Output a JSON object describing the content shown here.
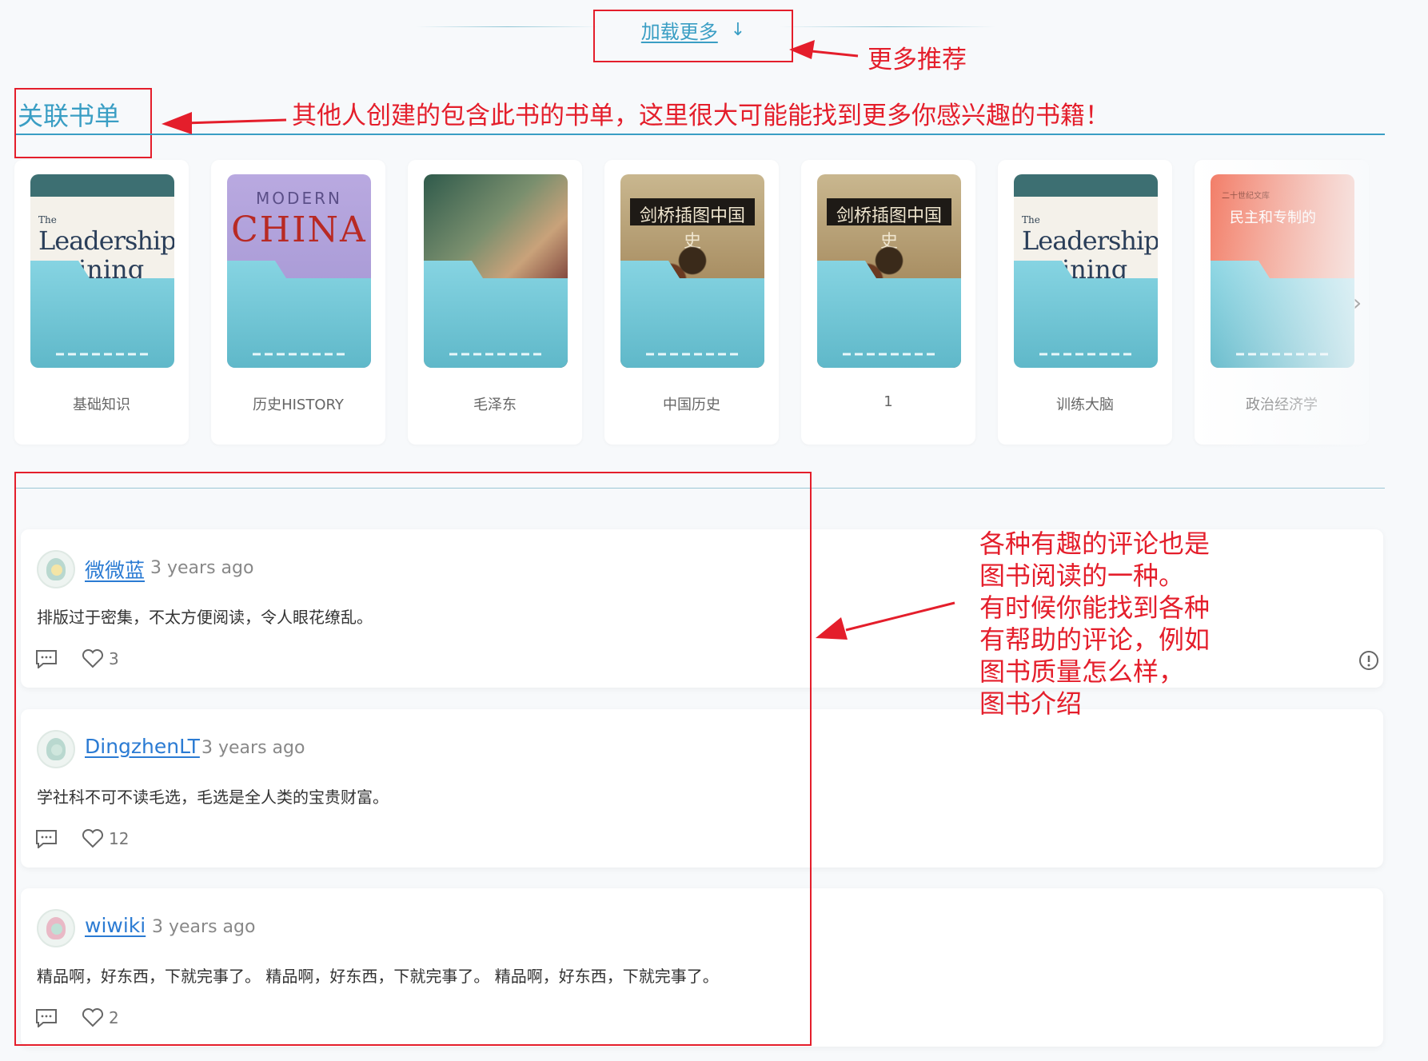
{
  "load_more": {
    "label": "加载更多",
    "arrow": "↓"
  },
  "annotations": {
    "more_recommend": "更多推荐",
    "booklist_hint": "其他人创建的包含此书的书单，这里很大可能能找到更多你感兴趣的书籍！",
    "comments_hint": [
      "各种有趣的评论也是",
      "图书阅读的一种。",
      "有时候你能找到各种",
      "有帮助的评论，例如",
      "图书质量怎么样，",
      "图书介绍"
    ]
  },
  "section": {
    "title": "关联书单"
  },
  "booklists": [
    {
      "name": "基础知识",
      "cover": "leadership",
      "cover_texts": [
        "The",
        "Leadership",
        "ining"
      ]
    },
    {
      "name": "历史HISTORY",
      "cover": "modern-china",
      "cover_texts": [
        "MODERN",
        "CHINA"
      ]
    },
    {
      "name": "毛泽东",
      "cover": "mao",
      "cover_texts": []
    },
    {
      "name": "中国历史",
      "cover": "cambridge",
      "cover_texts": [
        "剑桥插图中国史"
      ]
    },
    {
      "name": "1",
      "cover": "cambridge",
      "cover_texts": [
        "剑桥插图中国史"
      ]
    },
    {
      "name": "训练大脑",
      "cover": "leadership",
      "cover_texts": [
        "The",
        "Leadership",
        "ining"
      ]
    },
    {
      "name": "政治经济学",
      "cover": "politics",
      "cover_texts": [
        "民主和专制的",
        "二十世纪文库"
      ]
    }
  ],
  "next_icon": "chevron-right-icon",
  "comments": [
    {
      "user": "微微蓝",
      "time": "3 years ago",
      "text": "排版过于密集，不太方便阅读，令人眼花缭乱。",
      "likes": "3",
      "show_report": true
    },
    {
      "user": "DingzhenLT",
      "time": "3 years ago",
      "text": "学社科不可不读毛选，毛选是全人类的宝贵财富。",
      "likes": "12",
      "show_report": false
    },
    {
      "user": "wiwiki",
      "time": "3 years ago",
      "text": "精品啊，好东西，下就完事了。 精品啊，好东西，下就完事了。 精品啊，好东西，下就完事了。",
      "likes": "2",
      "show_report": false
    }
  ],
  "colors": {
    "accent": "#3a9ec4",
    "annotation": "#e41e2b",
    "link": "#2b7bd3",
    "folder": "#6fc6d6"
  }
}
